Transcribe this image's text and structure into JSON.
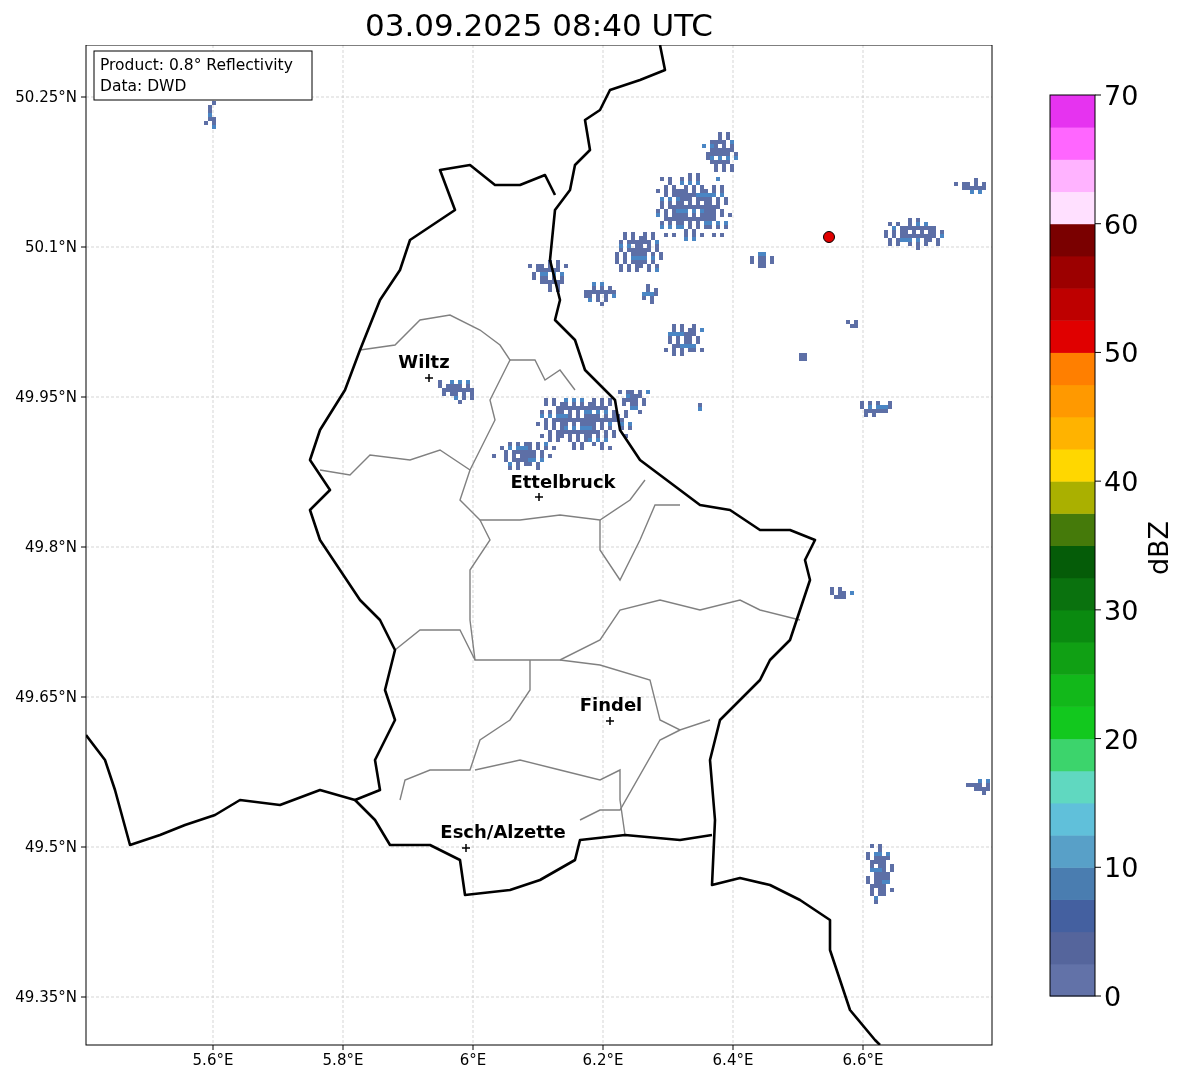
{
  "title": "03.09.2025 08:40 UTC",
  "info_box": [
    "Product: 0.8° Reflectivity",
    "Data: DWD"
  ],
  "map": {
    "xticks": [
      "5.6°E",
      "5.8°E",
      "6°E",
      "6.2°E",
      "6.4°E",
      "6.6°E"
    ],
    "yticks": [
      "50.25°N",
      "50.1°N",
      "49.95°N",
      "49.8°N",
      "49.65°N",
      "49.5°N",
      "49.35°N"
    ],
    "cities": [
      {
        "name": "Wiltz"
      },
      {
        "name": "Ettelbruck"
      },
      {
        "name": "Findel"
      },
      {
        "name": "Esch/Alzette"
      }
    ],
    "radar_site": {
      "color": "#e00000"
    }
  },
  "colorbar": {
    "label": "dBZ",
    "ticks": [
      "70",
      "60",
      "50",
      "40",
      "30",
      "20",
      "10",
      "0"
    ],
    "segments": [
      {
        "color": "#6272a8"
      },
      {
        "color": "#55659c"
      },
      {
        "color": "#4460a0"
      },
      {
        "color": "#4a7db0"
      },
      {
        "color": "#58a0c8"
      },
      {
        "color": "#60c0da"
      },
      {
        "color": "#60d8c0"
      },
      {
        "color": "#3cd46c"
      },
      {
        "color": "#12c81e"
      },
      {
        "color": "#12b81a"
      },
      {
        "color": "#10a014"
      },
      {
        "color": "#0a8a10"
      },
      {
        "color": "#0a720e"
      },
      {
        "color": "#055c08"
      },
      {
        "color": "#457a0a"
      },
      {
        "color": "#aab000"
      },
      {
        "color": "#ffd700"
      },
      {
        "color": "#ffb300"
      },
      {
        "color": "#ff9900"
      },
      {
        "color": "#ff7f00"
      },
      {
        "color": "#e00000"
      },
      {
        "color": "#be0000"
      },
      {
        "color": "#9c0000"
      },
      {
        "color": "#7a0000"
      },
      {
        "color": "#ffe0ff"
      },
      {
        "color": "#ffb3ff"
      },
      {
        "color": "#ff66ff"
      },
      {
        "color": "#e633f0"
      }
    ]
  }
}
